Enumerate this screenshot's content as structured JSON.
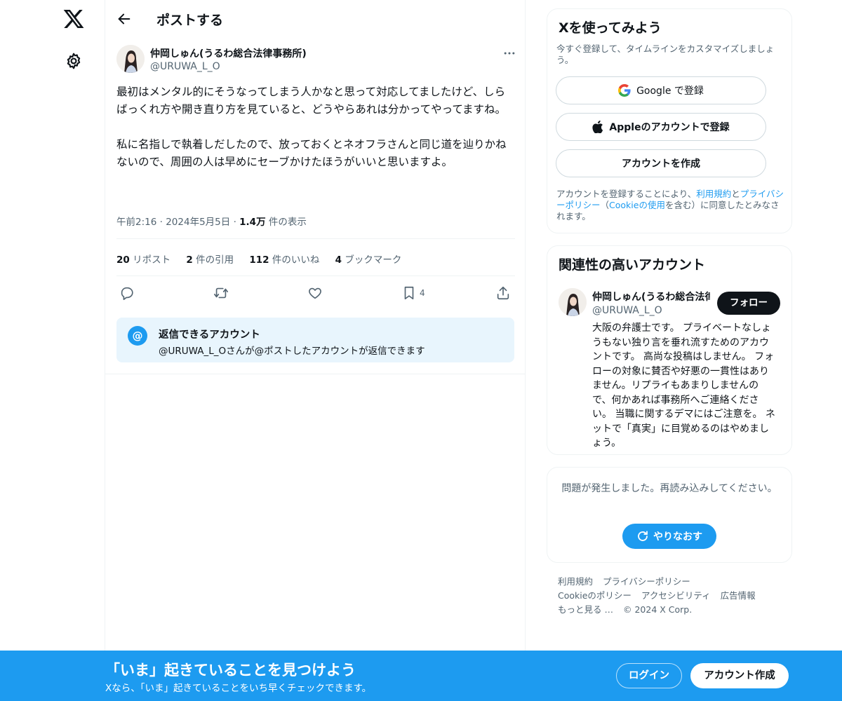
{
  "colors": {
    "accent": "#1d9bf0",
    "text": "#0f1419",
    "muted": "#536471",
    "border": "#eff3f4"
  },
  "header": {
    "title": "ポストする"
  },
  "post": {
    "author_name": "仲岡しゅん(うるわ総合法律事務所)",
    "author_handle": "@URUWA_L_O",
    "text": "最初はメンタル的にそうなってしまう人かなと思って対応してましたけど、しらばっくれ方や開き直り方を見ていると、どうやらあれは分かってやってますね。\n\n私に名指しで執着しだしたので、放っておくとネオフラさんと同じ道を辿りかねないので、周囲の人は早めにセーブかけたほうがいいと思いますよ。",
    "time": "午前2:16",
    "date": "2024年5月5日",
    "views_count": "1.4万",
    "views_label": "件の表示",
    "stats": {
      "reposts_count": "20",
      "reposts_label": "リポスト",
      "quotes_count": "2",
      "quotes_label": "件の引用",
      "likes_count": "112",
      "likes_label": "件のいいね",
      "bookmarks_count": "4",
      "bookmarks_label": "ブックマーク"
    },
    "bookmark_action_count": "4"
  },
  "reply_restriction": {
    "icon": "@",
    "title": "返信できるアカウント",
    "subtitle": "@URUWA_L_Oさんが@ポストしたアカウントが返信できます"
  },
  "signup_card": {
    "title": "Xを使ってみよう",
    "subtitle": "今すぐ登録して、タイムラインをカスタマイズしましょう。",
    "google_label": "Google で登録",
    "apple_label": "Appleのアカウントで登録",
    "create_label": "アカウントを作成",
    "legal_prefix": "アカウントを登録することにより、",
    "legal_terms": "利用規約",
    "legal_and": "と",
    "legal_privacy": "プライバシーポリシー",
    "legal_open": "（",
    "legal_cookie": "Cookieの使用",
    "legal_suffix": "を含む）に同意したとみなされます。"
  },
  "related_card": {
    "title": "関連性の高いアカウント",
    "name": "仲岡しゅん(うるわ総合法律事務所)",
    "handle": "@URUWA_L_O",
    "follow_label": "フォロー",
    "bio": "大阪の弁護士です。 プライベートなしょうもない独り言を垂れ流すためのアカウントです。 高尚な投稿はしません。 フォローの対象に賛否や好悪の一貫性はありません。リプライもあまりしませんので、何かあれば事務所へご連絡ください。 当職に関するデマにはご注意を。 ネットで「真実」に目覚めるのはやめましょう。"
  },
  "error_card": {
    "message": "問題が発生しました。再読み込みしてください。",
    "retry_label": "やりなおす"
  },
  "footer": {
    "links": [
      "利用規約",
      "プライバシーポリシー",
      "Cookieのポリシー",
      "アクセシビリティ",
      "広告情報",
      "もっと見る …",
      "© 2024 X Corp."
    ]
  },
  "banner": {
    "heading": "「いま」起きていることを見つけよう",
    "subheading": "Xなら、「いま」起きていることをいち早くチェックできます。",
    "login_label": "ログイン",
    "create_label": "アカウント作成"
  }
}
